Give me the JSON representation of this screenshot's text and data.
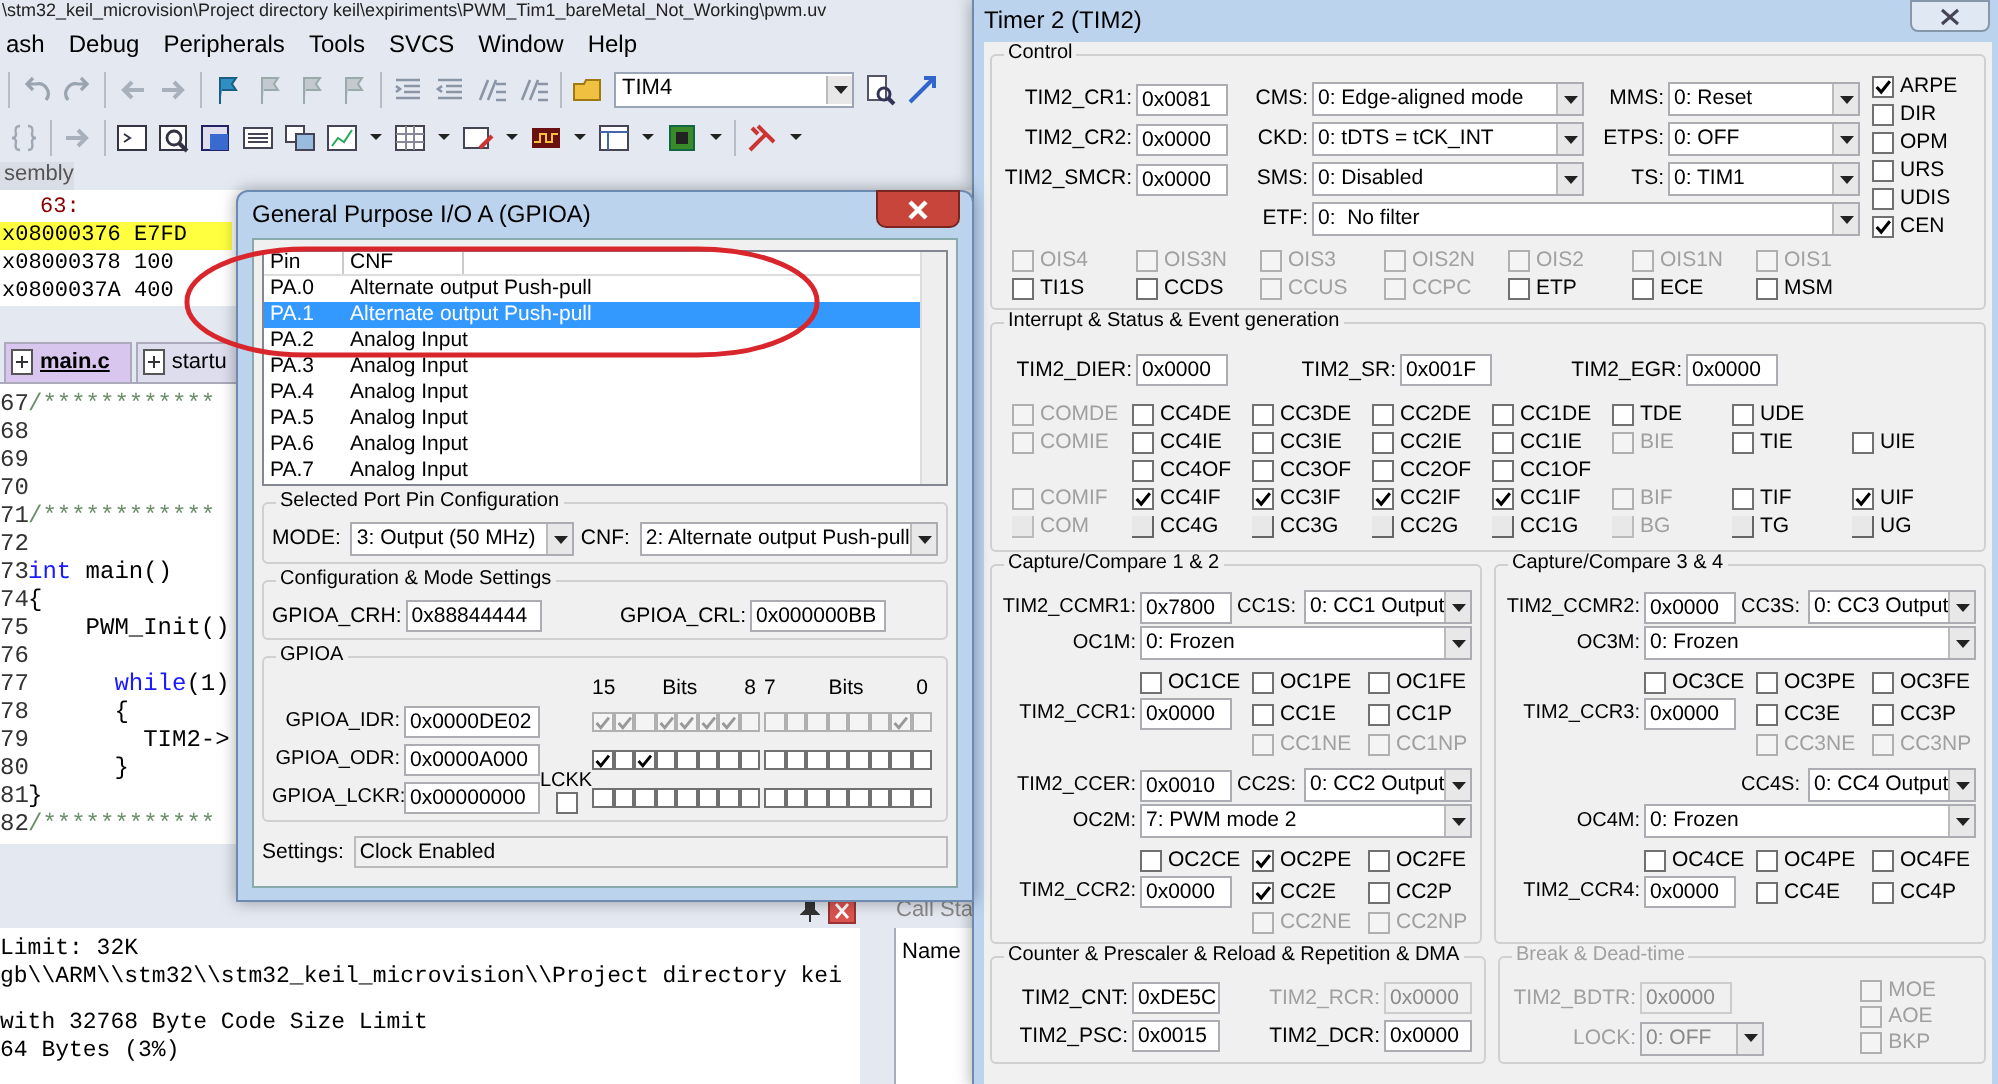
{
  "ide": {
    "title": "\\stm32_keil_microvision\\Project directory keil\\expiriments\\PWM_Tim1_bareMetal_Not_Working\\pwm.uv",
    "menu": [
      "ash",
      "Debug",
      "Peripherals",
      "Tools",
      "SVCS",
      "Window",
      "Help"
    ],
    "target": "TIM4",
    "pane_label": "sembly",
    "disassembly": [
      {
        "kind": "source",
        "text": "63:",
        "current": false
      },
      {
        "kind": "instruction",
        "address": "x08000376",
        "opcode": "E7FD",
        "current": true
      },
      {
        "kind": "instruction",
        "address": "x08000378",
        "opcode": "100",
        "current": false
      },
      {
        "kind": "instruction",
        "address": "x0800037A",
        "opcode": "400",
        "current": false
      }
    ],
    "tabs": [
      {
        "label": "main.c",
        "selected": true
      },
      {
        "label": "startu",
        "selected": false
      }
    ],
    "code_lines": [
      {
        "number": "67",
        "parts": [
          {
            "text": "/************",
            "kind": "comment"
          }
        ]
      },
      {
        "number": "68"
      },
      {
        "number": "69"
      },
      {
        "number": "70"
      },
      {
        "number": "71",
        "parts": [
          {
            "text": "/************",
            "kind": "comment"
          }
        ]
      },
      {
        "number": "72"
      },
      {
        "number": "73",
        "parts": [
          {
            "text": "int",
            "kind": "keyword"
          },
          {
            "text": " main()",
            "kind": "plain"
          }
        ]
      },
      {
        "number": "74",
        "parts": [
          {
            "text": "{",
            "kind": "plain"
          }
        ]
      },
      {
        "number": "75",
        "parts": [
          {
            "text": "    PWM_Init()",
            "kind": "plain"
          }
        ]
      },
      {
        "number": "76"
      },
      {
        "number": "77",
        "parts": [
          {
            "text": "      while",
            "kind": "keyword"
          },
          {
            "text": "(1)",
            "kind": "plain"
          }
        ]
      },
      {
        "number": "78",
        "parts": [
          {
            "text": "      {",
            "kind": "plain"
          }
        ]
      },
      {
        "number": "79",
        "parts": [
          {
            "text": "        TIM2->",
            "kind": "plain"
          }
        ]
      },
      {
        "number": "80",
        "parts": [
          {
            "text": "      }",
            "kind": "plain"
          }
        ]
      },
      {
        "number": "81",
        "parts": [
          {
            "text": "}",
            "kind": "plain"
          }
        ]
      },
      {
        "number": "82",
        "parts": [
          {
            "text": "/************",
            "kind": "comment"
          }
        ]
      }
    ],
    "build_output": [
      [
        "Limit: 32K",
        "gb\\\\ARM\\\\stm32\\\\stm32_keil_microvision\\\\Project directory kei"
      ],
      [
        "with 32768 Byte Code Size Limit",
        "64 Bytes (3%)"
      ]
    ],
    "call_stack": {
      "title": "Call Sta",
      "column": "Name"
    }
  },
  "gpio": {
    "title": "General Purpose I/O A (GPIOA)",
    "columns": [
      "Pin",
      "CNF"
    ],
    "pins": [
      {
        "pin": "PA.0",
        "cnf": "Alternate output Push-pull",
        "selected": false
      },
      {
        "pin": "PA.1",
        "cnf": "Alternate output Push-pull",
        "selected": true
      },
      {
        "pin": "PA.2",
        "cnf": "Analog Input",
        "selected": false
      },
      {
        "pin": "PA.3",
        "cnf": "Analog Input",
        "selected": false
      },
      {
        "pin": "PA.4",
        "cnf": "Analog Input",
        "selected": false
      },
      {
        "pin": "PA.5",
        "cnf": "Analog Input",
        "selected": false
      },
      {
        "pin": "PA.6",
        "cnf": "Analog Input",
        "selected": false
      },
      {
        "pin": "PA.7",
        "cnf": "Analog Input",
        "selected": false
      }
    ],
    "pin_config": {
      "title": "Selected Port Pin Configuration",
      "mode": {
        "label": "MODE:",
        "value": "3: Output (50 MHz)"
      },
      "cnf": {
        "label": "CNF:",
        "value": "2: Alternate output Push-pull"
      }
    },
    "mode_settings": {
      "title": "Configuration & Mode Settings",
      "registers": [
        {
          "label": "GPIOA_CRH:",
          "value": "0x88844444"
        },
        {
          "label": "GPIOA_CRL:",
          "value": "0x000000BB"
        }
      ]
    },
    "port": {
      "title": "GPIOA",
      "bit_headers": [
        "15",
        "Bits",
        "8",
        "7",
        "Bits",
        "0"
      ],
      "lock_label": "LCKK",
      "registers": [
        {
          "label": "GPIOA_IDR:",
          "value": "0x0000DE02",
          "bits_disabled": true,
          "bits": [
            {
              "checked": true
            },
            {
              "checked": true
            },
            {
              "checked": false
            },
            {
              "checked": true
            },
            {
              "checked": true
            },
            {
              "checked": true
            },
            {
              "checked": true
            },
            {
              "checked": false
            },
            {
              "checked": false
            },
            {
              "checked": false
            },
            {
              "checked": false
            },
            {
              "checked": false
            },
            {
              "checked": false
            },
            {
              "checked": false
            },
            {
              "checked": true
            },
            {
              "checked": false
            }
          ]
        },
        {
          "label": "GPIOA_ODR:",
          "value": "0x0000A000",
          "bits_disabled": false,
          "bits": [
            {
              "checked": true
            },
            {
              "checked": false
            },
            {
              "checked": true
            },
            {
              "checked": false
            },
            {
              "checked": false
            },
            {
              "checked": false
            },
            {
              "checked": false
            },
            {
              "checked": false
            },
            {
              "checked": false
            },
            {
              "checked": false
            },
            {
              "checked": false
            },
            {
              "checked": false
            },
            {
              "checked": false
            },
            {
              "checked": false
            },
            {
              "checked": false
            },
            {
              "checked": false
            }
          ]
        },
        {
          "label": "GPIOA_LCKR:",
          "value": "0x00000000",
          "bits_disabled": false,
          "lckk": {
            "checked": false
          },
          "bits": [
            {
              "checked": false
            },
            {
              "checked": false
            },
            {
              "checked": false
            },
            {
              "checked": false
            },
            {
              "checked": false
            },
            {
              "checked": false
            },
            {
              "checked": false
            },
            {
              "checked": false
            },
            {
              "checked": false
            },
            {
              "checked": false
            },
            {
              "checked": false
            },
            {
              "checked": false
            },
            {
              "checked": false
            },
            {
              "checked": false
            },
            {
              "checked": false
            },
            {
              "checked": false
            }
          ]
        }
      ]
    },
    "settings": {
      "label": "Settings:",
      "value": "Clock Enabled"
    }
  },
  "timer": {
    "title": "Timer 2 (TIM2)",
    "control": {
      "title": "Control",
      "registers": [
        {
          "label": "TIM2_CR1:",
          "value": "0x0081"
        },
        {
          "label": "TIM2_CR2:",
          "value": "0x0000"
        },
        {
          "label": "TIM2_SMCR:",
          "value": "0x0000"
        }
      ],
      "selects": [
        [
          {
            "label": "CMS:",
            "value": "0: Edge-aligned mode"
          },
          {
            "label": "MMS:",
            "value": "0: Reset"
          }
        ],
        [
          {
            "label": "CKD:",
            "value": "0: tDTS = tCK_INT"
          },
          {
            "label": "ETPS:",
            "value": "0: OFF"
          }
        ],
        [
          {
            "label": "SMS:",
            "value": "0: Disabled"
          },
          {
            "label": "TS:",
            "value": "0: TIM1"
          }
        ]
      ],
      "filter": {
        "label": "ETF:",
        "value": "0:  No filter"
      },
      "flags": [
        {
          "label": "ARPE",
          "checked": true,
          "disabled": false
        },
        {
          "label": "DIR",
          "checked": false,
          "disabled": false
        },
        {
          "label": "OPM",
          "checked": false,
          "disabled": false
        },
        {
          "label": "URS",
          "checked": false,
          "disabled": false
        },
        {
          "label": "UDIS",
          "checked": false,
          "disabled": false
        },
        {
          "label": "CEN",
          "checked": true,
          "disabled": false
        }
      ],
      "bit_rows": [
        [
          {
            "label": "OIS4",
            "checked": false,
            "disabled": true
          },
          {
            "label": "OIS3N",
            "checked": false,
            "disabled": true
          },
          {
            "label": "OIS3",
            "checked": false,
            "disabled": true
          },
          {
            "label": "OIS2N",
            "checked": false,
            "disabled": true
          },
          {
            "label": "OIS2",
            "checked": false,
            "disabled": true
          },
          {
            "label": "OIS1N",
            "checked": false,
            "disabled": true
          },
          {
            "label": "OIS1",
            "checked": false,
            "disabled": true
          }
        ],
        [
          {
            "label": "TI1S",
            "checked": false,
            "disabled": false
          },
          {
            "label": "CCDS",
            "checked": false,
            "disabled": false
          },
          {
            "label": "CCUS",
            "checked": false,
            "disabled": true
          },
          {
            "label": "CCPC",
            "checked": false,
            "disabled": true
          },
          {
            "label": "ETP",
            "checked": false,
            "disabled": false
          },
          {
            "label": "ECE",
            "checked": false,
            "disabled": false
          },
          {
            "label": "MSM",
            "checked": false,
            "disabled": false
          }
        ]
      ]
    },
    "interrupt": {
      "title": "Interrupt & Status & Event generation",
      "registers": [
        {
          "label": "TIM2_DIER:",
          "value": "0x0000"
        },
        {
          "label": "TIM2_SR:",
          "value": "0x001F"
        },
        {
          "label": "TIM2_EGR:",
          "value": "0x0000"
        }
      ],
      "bit_rows": [
        [
          {
            "kind": "check",
            "label": "COMDE",
            "checked": false,
            "disabled": true
          },
          {
            "kind": "check",
            "label": "CC4DE",
            "checked": false,
            "disabled": false
          },
          {
            "kind": "check",
            "label": "CC3DE",
            "checked": false,
            "disabled": false
          },
          {
            "kind": "check",
            "label": "CC2DE",
            "checked": false,
            "disabled": false
          },
          {
            "kind": "check",
            "label": "CC1DE",
            "checked": false,
            "disabled": false
          },
          {
            "kind": "check",
            "label": "TDE",
            "checked": false,
            "disabled": false
          },
          {
            "kind": "check",
            "label": "UDE",
            "checked": false,
            "disabled": false
          },
          null
        ],
        [
          {
            "kind": "check",
            "label": "COMIE",
            "checked": false,
            "disabled": true
          },
          {
            "kind": "check",
            "label": "CC4IE",
            "checked": false,
            "disabled": false
          },
          {
            "kind": "check",
            "label": "CC3IE",
            "checked": false,
            "disabled": false
          },
          {
            "kind": "check",
            "label": "CC2IE",
            "checked": false,
            "disabled": false
          },
          {
            "kind": "check",
            "label": "CC1IE",
            "checked": false,
            "disabled": false
          },
          {
            "kind": "check",
            "label": "BIE",
            "checked": false,
            "disabled": true
          },
          {
            "kind": "check",
            "label": "TIE",
            "checked": false,
            "disabled": false
          },
          {
            "kind": "check",
            "label": "UIE",
            "checked": false,
            "disabled": false
          }
        ],
        [
          null,
          {
            "kind": "check",
            "label": "CC4OF",
            "checked": false,
            "disabled": false
          },
          {
            "kind": "check",
            "label": "CC3OF",
            "checked": false,
            "disabled": false
          },
          {
            "kind": "check",
            "label": "CC2OF",
            "checked": false,
            "disabled": false
          },
          {
            "kind": "check",
            "label": "CC1OF",
            "checked": false,
            "disabled": false
          },
          null,
          null,
          null
        ],
        [
          {
            "kind": "check",
            "label": "COMIF",
            "checked": false,
            "disabled": true
          },
          {
            "kind": "check",
            "label": "CC4IF",
            "checked": true,
            "disabled": false
          },
          {
            "kind": "check",
            "label": "CC3IF",
            "checked": true,
            "disabled": false
          },
          {
            "kind": "check",
            "label": "CC2IF",
            "checked": true,
            "disabled": false
          },
          {
            "kind": "check",
            "label": "CC1IF",
            "checked": true,
            "disabled": false
          },
          {
            "kind": "check",
            "label": "BIF",
            "checked": false,
            "disabled": true
          },
          {
            "kind": "check",
            "label": "TIF",
            "checked": false,
            "disabled": false
          },
          {
            "kind": "check",
            "label": "UIF",
            "checked": true,
            "disabled": false
          }
        ],
        [
          {
            "kind": "trigger",
            "label": "COM",
            "disabled": true
          },
          {
            "kind": "trigger",
            "label": "CC4G",
            "disabled": false
          },
          {
            "kind": "trigger",
            "label": "CC3G",
            "disabled": false
          },
          {
            "kind": "trigger",
            "label": "CC2G",
            "disabled": false
          },
          {
            "kind": "trigger",
            "label": "CC1G",
            "disabled": false
          },
          {
            "kind": "trigger",
            "label": "BG",
            "disabled": true
          },
          {
            "kind": "trigger",
            "label": "TG",
            "disabled": false
          },
          {
            "kind": "trigger",
            "label": "UG",
            "disabled": false
          }
        ]
      ]
    },
    "capture_groups": [
      {
        "title": "Capture/Compare 1 & 2",
        "channels": [
          {
            "register": {
              "label": "TIM2_CCMR1:",
              "value": "0x7800"
            },
            "selection": {
              "label": "CC1S:",
              "value": "0: CC1 Output"
            },
            "output_mode": {
              "label": "OC1M:",
              "value": "0: Frozen"
            },
            "compare": {
              "label": "TIM2_CCR1:",
              "value": "0x0000"
            },
            "flags": [
              [
                {
                  "label": "OC1CE",
                  "checked": false,
                  "disabled": false
                },
                {
                  "label": "OC1PE",
                  "checked": false,
                  "disabled": false
                },
                {
                  "label": "OC1FE",
                  "checked": false,
                  "disabled": false
                }
              ],
              [
                {
                  "label": "CC1E",
                  "checked": false,
                  "disabled": false
                },
                {
                  "label": "CC1P",
                  "checked": false,
                  "disabled": false
                }
              ],
              [
                {
                  "label": "CC1NE",
                  "checked": false,
                  "disabled": true
                },
                {
                  "label": "CC1NP",
                  "checked": false,
                  "disabled": true
                }
              ]
            ]
          },
          {
            "register": {
              "label": "TIM2_CCER:",
              "value": "0x0010"
            },
            "selection": {
              "label": "CC2S:",
              "value": "0: CC2 Output"
            },
            "output_mode": {
              "label": "OC2M:",
              "value": "7: PWM mode 2"
            },
            "compare": {
              "label": "TIM2_CCR2:",
              "value": "0x0000"
            },
            "flags": [
              [
                {
                  "label": "OC2CE",
                  "checked": false,
                  "disabled": false
                },
                {
                  "label": "OC2PE",
                  "checked": true,
                  "disabled": false
                },
                {
                  "label": "OC2FE",
                  "checked": false,
                  "disabled": false
                }
              ],
              [
                {
                  "label": "CC2E",
                  "checked": true,
                  "disabled": false
                },
                {
                  "label": "CC2P",
                  "checked": false,
                  "disabled": false
                }
              ],
              [
                {
                  "label": "CC2NE",
                  "checked": false,
                  "disabled": true
                },
                {
                  "label": "CC2NP",
                  "checked": false,
                  "disabled": true
                }
              ]
            ]
          }
        ]
      },
      {
        "title": "Capture/Compare 3 & 4",
        "channels": [
          {
            "register": {
              "label": "TIM2_CCMR2:",
              "value": "0x0000"
            },
            "selection": {
              "label": "CC3S:",
              "value": "0: CC3 Output"
            },
            "output_mode": {
              "label": "OC3M:",
              "value": "0: Frozen"
            },
            "compare": {
              "label": "TIM2_CCR3:",
              "value": "0x0000"
            },
            "flags": [
              [
                {
                  "label": "OC3CE",
                  "checked": false,
                  "disabled": false
                },
                {
                  "label": "OC3PE",
                  "checked": false,
                  "disabled": false
                },
                {
                  "label": "OC3FE",
                  "checked": false,
                  "disabled": false
                }
              ],
              [
                {
                  "label": "CC3E",
                  "checked": false,
                  "disabled": false
                },
                {
                  "label": "CC3P",
                  "checked": false,
                  "disabled": false
                }
              ],
              [
                {
                  "label": "CC3NE",
                  "checked": false,
                  "disabled": true
                },
                {
                  "label": "CC3NP",
                  "checked": false,
                  "disabled": true
                }
              ]
            ]
          },
          {
            "selection": {
              "label": "CC4S:",
              "value": "0: CC4 Output"
            },
            "output_mode": {
              "label": "OC4M:",
              "value": "0: Frozen"
            },
            "compare": {
              "label": "TIM2_CCR4:",
              "value": "0x0000"
            },
            "flags": [
              [
                {
                  "label": "OC4CE",
                  "checked": false,
                  "disabled": false
                },
                {
                  "label": "OC4PE",
                  "checked": false,
                  "disabled": false
                },
                {
                  "label": "OC4FE",
                  "checked": false,
                  "disabled": false
                }
              ],
              [
                {
                  "label": "CC4E",
                  "checked": false,
                  "disabled": false
                },
                {
                  "label": "CC4P",
                  "checked": false,
                  "disabled": false
                }
              ]
            ]
          }
        ]
      }
    ],
    "counter": {
      "title": "Counter & Prescaler & Reload & Repetition & DMA",
      "fields": [
        {
          "label": "TIM2_CNT:",
          "value": "0xDE5C",
          "disabled": false
        },
        {
          "label": "TIM2_RCR:",
          "value": "0x0000",
          "disabled": true
        },
        {
          "label": "TIM2_PSC:",
          "value": "0x0015",
          "disabled": false
        },
        {
          "label": "TIM2_DCR:",
          "value": "0x0000",
          "disabled": false
        }
      ]
    },
    "break": {
      "title": "Break & Dead-time",
      "disabled": true,
      "register": {
        "label": "TIM2_BDTR:",
        "value": "0x0000"
      },
      "lock": {
        "label": "LOCK:",
        "value": "0: OFF"
      },
      "flags": [
        {
          "label": "MOE",
          "checked": false
        },
        {
          "label": "AOE",
          "checked": false
        },
        {
          "label": "BKP",
          "checked": false
        }
      ]
    }
  }
}
